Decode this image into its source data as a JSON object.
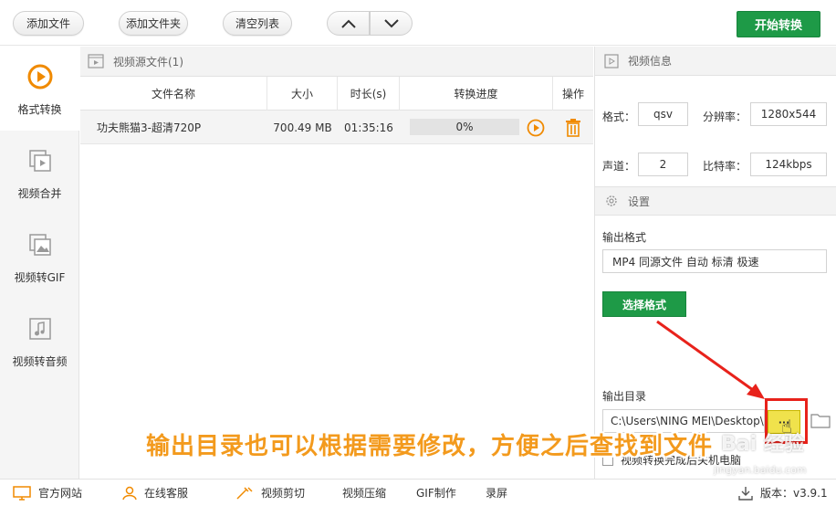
{
  "toolbar": {
    "add_file": "添加文件",
    "add_folder": "添加文件夹",
    "clear_list": "清空列表",
    "start": "开始转换"
  },
  "sidebar": {
    "items": [
      {
        "label": "格式转换",
        "icon": "convert-icon",
        "active": true
      },
      {
        "label": "视频合并",
        "icon": "merge-icon"
      },
      {
        "label": "视频转GIF",
        "icon": "gif-icon"
      },
      {
        "label": "视频转音频",
        "icon": "audio-icon"
      }
    ]
  },
  "source": {
    "header": "视频源文件(1)",
    "columns": [
      "文件名称",
      "大小",
      "时长(s)",
      "转换进度",
      "操作"
    ],
    "rows": [
      {
        "name": "功夫熊猫3-超清720P",
        "size": "700.49 MB",
        "duration": "01:35:16",
        "progress": "0%"
      }
    ]
  },
  "info": {
    "header": "视频信息",
    "format_label": "格式：",
    "format_value": "qsv",
    "resolution_label": "分辨率：",
    "resolution_value": "1280x544",
    "channel_label": "声道：",
    "channel_value": "2",
    "bitrate_label": "比特率：",
    "bitrate_value": "124kbps"
  },
  "settings": {
    "header": "设置",
    "output_format_label": "输出格式",
    "output_format_value": "MP4 同源文件 自动 标清 极速",
    "select_format": "选择格式",
    "output_dir_label": "输出目录",
    "output_dir_value": "C:\\Users\\NING MEI\\Desktop\\t",
    "browse": "···",
    "shutdown_label": "视频转换完成后关机电脑"
  },
  "bottom": {
    "website": "官方网站",
    "service": "在线客服",
    "cut": "视频剪切",
    "compress": "视频压缩",
    "gif": "GIF制作",
    "record": "录屏",
    "version": "版本：v3.9.1"
  },
  "caption": "输出目录也可以根据需要修改，方便之后查找到文件",
  "watermark": "Bai 经验",
  "watermark_url": "jingyan.baidu.com",
  "colors": {
    "accent_green": "#1e9a47",
    "accent_orange": "#f08a00",
    "highlight_red": "#e8221b"
  }
}
